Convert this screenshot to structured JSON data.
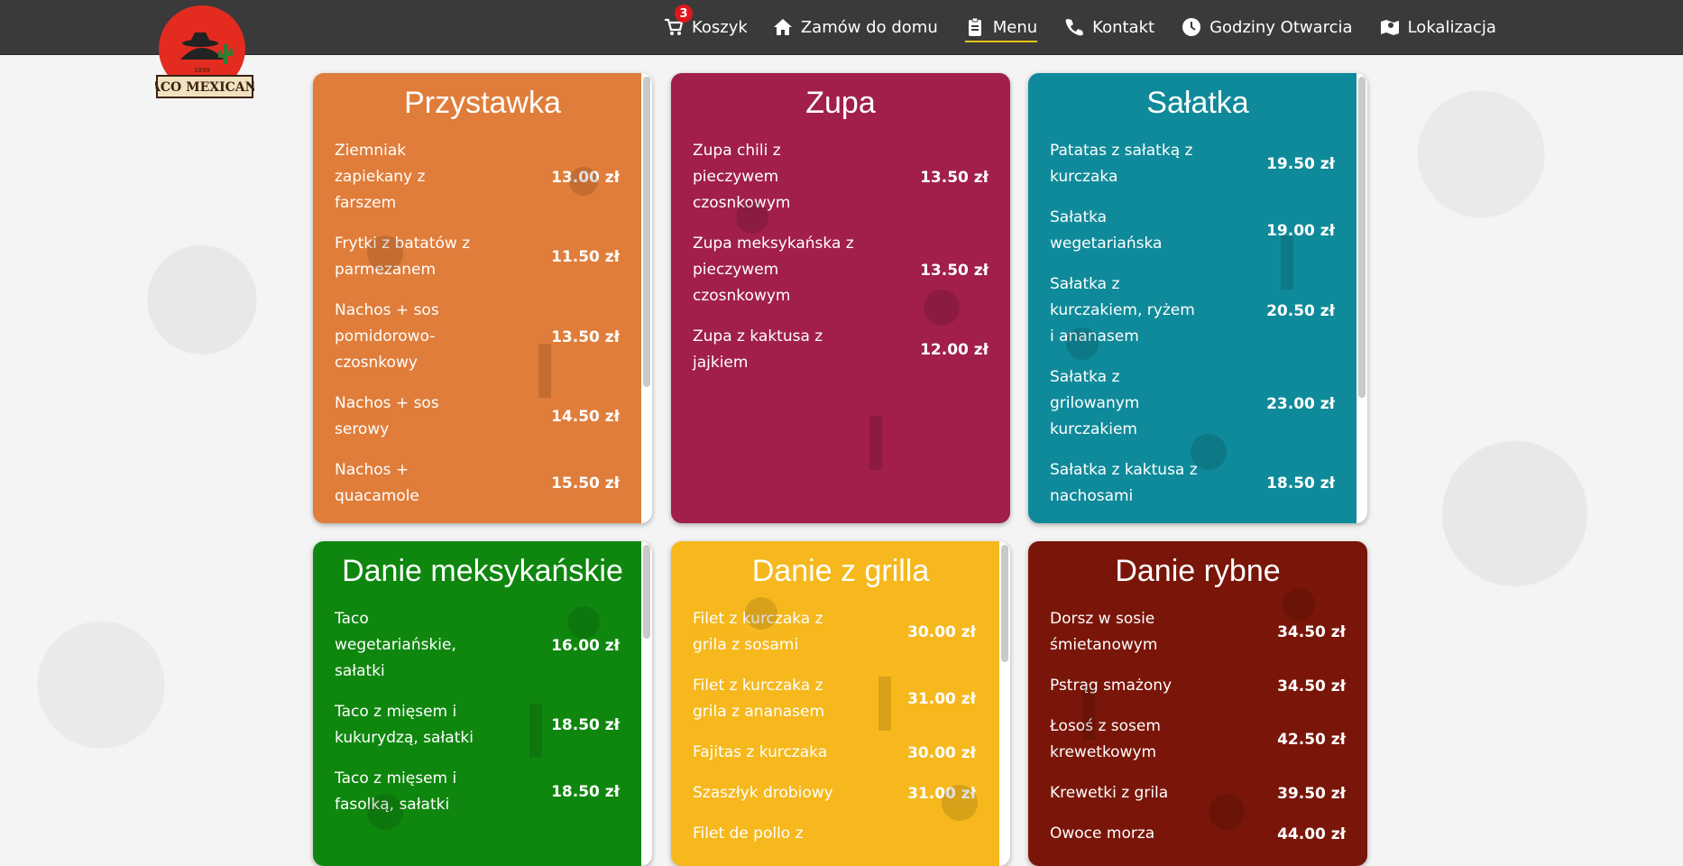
{
  "brand": {
    "logo_text": "TACO MEXICANO",
    "logo_year": "1999"
  },
  "nav": {
    "items": [
      {
        "label": "Koszyk",
        "icon": "cart-icon",
        "badge": "3"
      },
      {
        "label": "Zamów do domu",
        "icon": "home-icon"
      },
      {
        "label": "Menu",
        "icon": "clipboard-icon",
        "active": true
      },
      {
        "label": "Kontakt",
        "icon": "phone-icon"
      },
      {
        "label": "Godziny Otwarcia",
        "icon": "clock-icon"
      },
      {
        "label": "Lokalizacja",
        "icon": "map-icon"
      }
    ]
  },
  "categories": [
    {
      "title": "Przystawka",
      "color": "#e07d3a",
      "items": [
        {
          "name": "Ziemniak zapiekany z farszem",
          "price": "13.00 zł"
        },
        {
          "name": "Frytki z batatów z parmezanem",
          "price": "11.50 zł"
        },
        {
          "name": "Nachos + sos pomidorowo-czosnkowy",
          "price": "13.50 zł"
        },
        {
          "name": "Nachos + sos serowy",
          "price": "14.50 zł"
        },
        {
          "name": "Nachos + quacamole",
          "price": "15.50 zł"
        }
      ]
    },
    {
      "title": "Zupa",
      "color": "#a11f4a",
      "items": [
        {
          "name": "Zupa chili z pieczywem czosnkowym",
          "price": "13.50 zł"
        },
        {
          "name": "Zupa meksykańska z pieczywem czosnkowym",
          "price": "13.50 zł"
        },
        {
          "name": "Zupa z kaktusa z jajkiem",
          "price": "12.00 zł"
        }
      ]
    },
    {
      "title": "Sałatka",
      "color": "#0f8a9a",
      "items": [
        {
          "name": "Patatas z sałatką z kurczaka",
          "price": "19.50 zł"
        },
        {
          "name": "Sałatka wegetariańska",
          "price": "19.00 zł"
        },
        {
          "name": "Sałatka z kurczakiem, ryżem i ananasem",
          "price": "20.50 zł"
        },
        {
          "name": "Sałatka z grilowanym kurczakiem",
          "price": "23.00 zł"
        },
        {
          "name": "Sałatka z kaktusa z nachosami",
          "price": "18.50 zł"
        }
      ]
    },
    {
      "title": "Danie meksykańskie",
      "color": "#0f870f",
      "items": [
        {
          "name": "Taco wegetariańskie, sałatki",
          "price": "16.00 zł"
        },
        {
          "name": "Taco z mięsem i kukurydzą, sałatki",
          "price": "18.50 zł"
        },
        {
          "name": "Taco z mięsem i fasolką, sałatki",
          "price": "18.50 zł"
        }
      ]
    },
    {
      "title": "Danie z grilla",
      "color": "#f6b81d",
      "items": [
        {
          "name": "Filet z kurczaka z grila z sosami",
          "price": "30.00 zł"
        },
        {
          "name": "Filet z kurczaka z grila z ananasem",
          "price": "31.00 zł"
        },
        {
          "name": "Fajitas z kurczaka",
          "price": "30.00 zł"
        },
        {
          "name": "Szaszłyk drobiowy",
          "price": "31.00 zł"
        },
        {
          "name": "Filet de pollo z",
          "price": ""
        }
      ]
    },
    {
      "title": "Danie rybne",
      "color": "#7a1609",
      "items": [
        {
          "name": "Dorsz w sosie śmietanowym",
          "price": "34.50 zł"
        },
        {
          "name": "Pstrąg smażony",
          "price": "34.50 zł"
        },
        {
          "name": "Łosoś z sosem krewetkowym",
          "price": "42.50 zł"
        },
        {
          "name": "Krewetki z grila",
          "price": "39.50 zł"
        },
        {
          "name": "Owoce morza",
          "price": "44.00 zł"
        }
      ]
    }
  ]
}
